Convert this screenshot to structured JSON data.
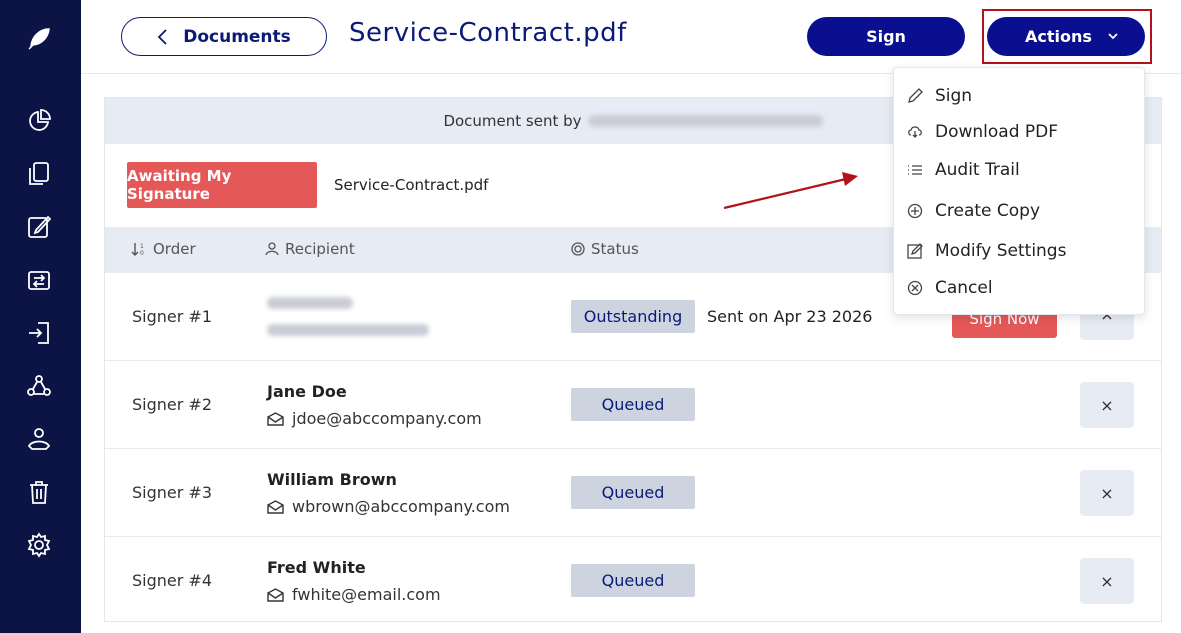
{
  "sidebar": {
    "logo_icon": "feather-icon",
    "items": [
      {
        "icon": "pie-chart-icon"
      },
      {
        "icon": "documents-icon"
      },
      {
        "icon": "edit-icon"
      },
      {
        "icon": "transfer-icon"
      },
      {
        "icon": "sign-in-icon"
      },
      {
        "icon": "people-icon"
      },
      {
        "icon": "user-hand-icon"
      },
      {
        "icon": "trash-icon"
      },
      {
        "icon": "gear-icon"
      }
    ]
  },
  "header": {
    "back_label": "Documents",
    "title": "Service-Contract.pdf",
    "sign_label": "Sign",
    "actions_label": "Actions"
  },
  "panel": {
    "sent_by_label": "Document sent by",
    "awaiting_label": "Awaiting My Signature",
    "file_name": "Service-Contract.pdf",
    "columns": {
      "order": "Order",
      "recipient": "Recipient",
      "status": "Status"
    },
    "rows": [
      {
        "order": "Signer #1",
        "name": "",
        "email": "",
        "status": "Outstanding",
        "sent_on": "Sent on Apr 23 2026",
        "action": "Sign Now"
      },
      {
        "order": "Signer #2",
        "name": "Jane Doe",
        "email": "jdoe@abccompany.com",
        "status": "Queued"
      },
      {
        "order": "Signer #3",
        "name": "William Brown",
        "email": "wbrown@abccompany.com",
        "status": "Queued"
      },
      {
        "order": "Signer #4",
        "name": "Fred White",
        "email": "fwhite@email.com",
        "status": "Queued"
      }
    ],
    "remove_symbol": "×"
  },
  "dropdown": {
    "items": [
      {
        "label": "Sign",
        "icon": "pencil-icon"
      },
      {
        "label": "Download PDF",
        "icon": "cloud-download-icon"
      },
      {
        "label": "Audit Trail",
        "icon": "list-icon"
      },
      {
        "label": "Create Copy",
        "icon": "plus-circle-icon"
      },
      {
        "label": "Modify Settings",
        "icon": "edit-settings-icon"
      },
      {
        "label": "Cancel",
        "icon": "close-circle-icon"
      }
    ]
  },
  "colors": {
    "sidebar": "#0b1445",
    "primary": "#0a0f8f",
    "danger": "#e45858",
    "highlight": "#b3121b"
  }
}
